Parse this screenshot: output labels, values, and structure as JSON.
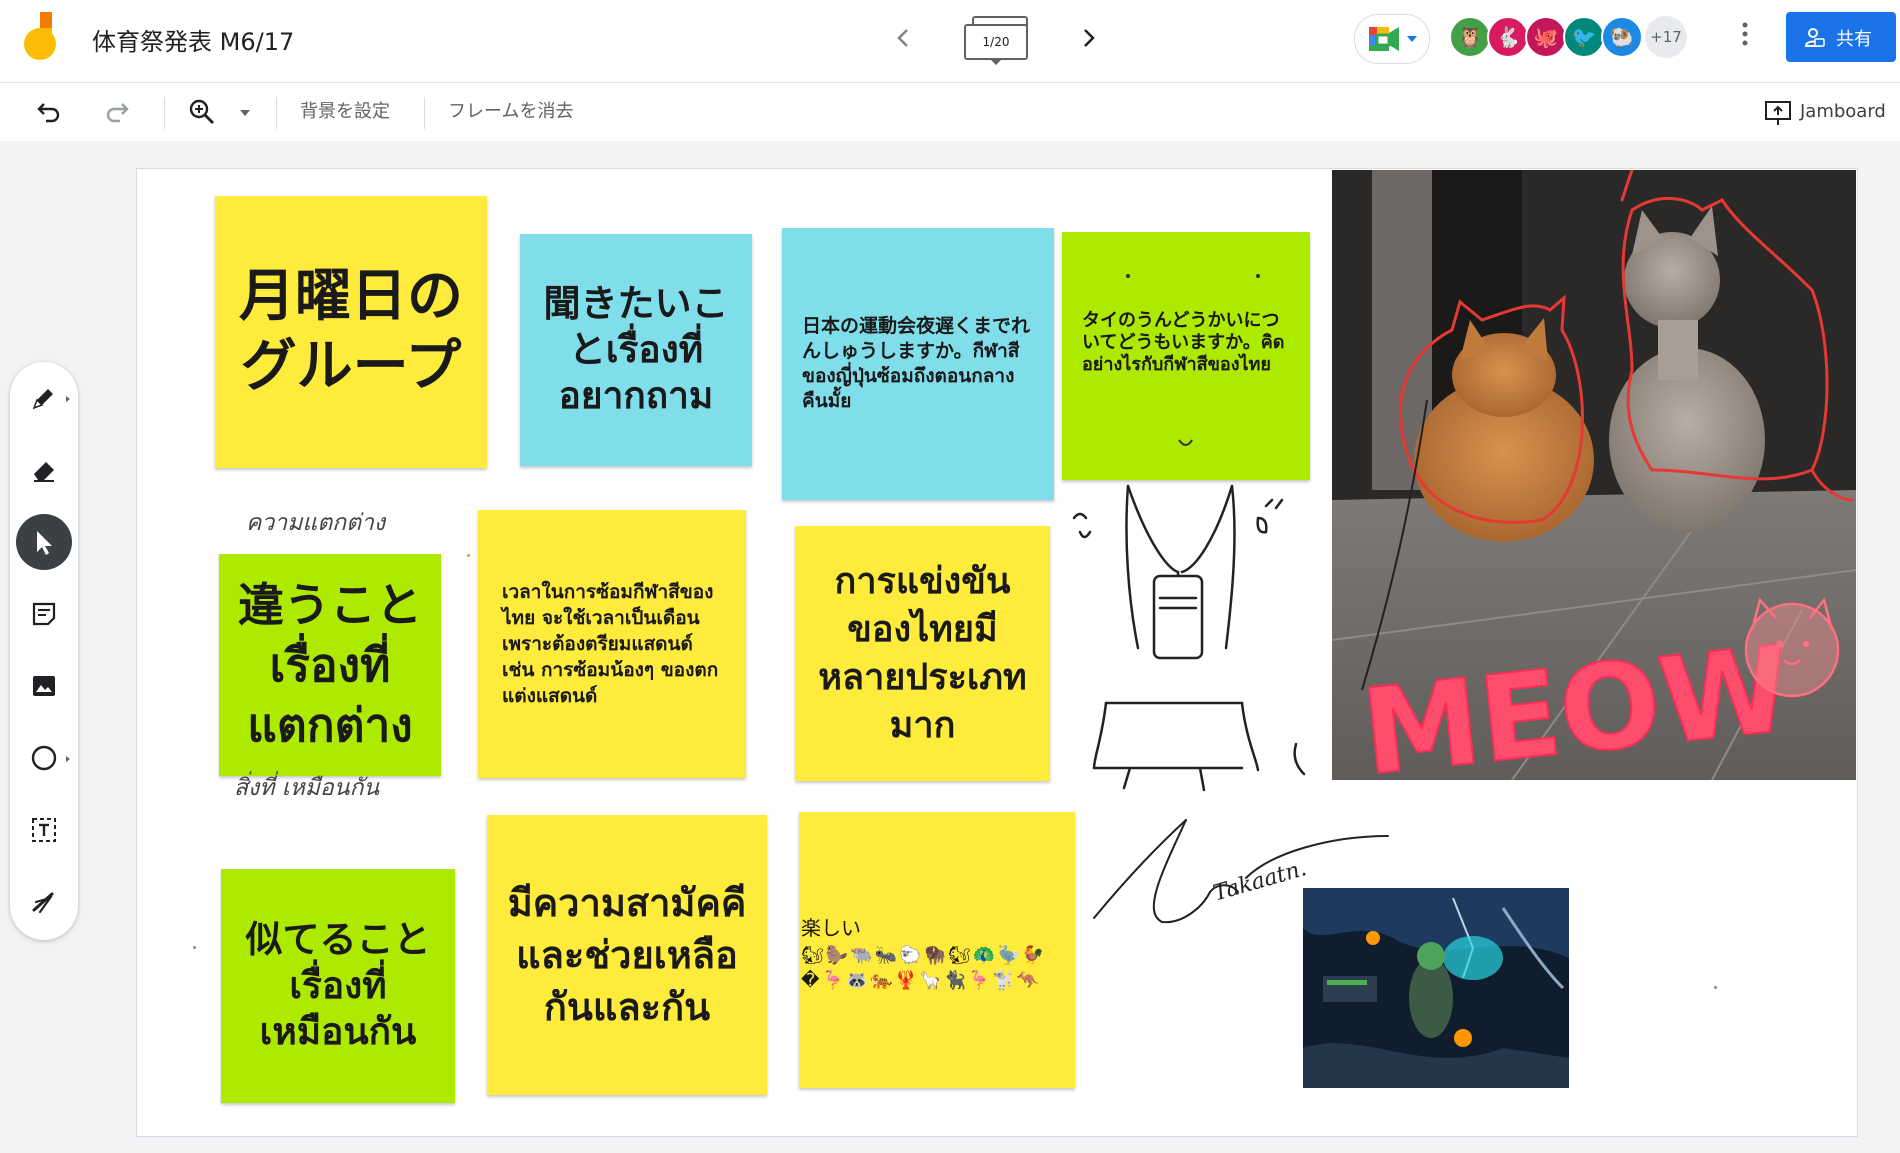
{
  "app": {
    "doc_title": "体育祭発表 M6/17",
    "frame_counter": "1/20",
    "share_label": "共有",
    "more_participants": "+17"
  },
  "toolbar": {
    "set_background": "背景を設定",
    "clear_frame": "フレームを消去",
    "jamboard": "Jamboard"
  },
  "colors": {
    "yellow_note": "#ffeb3b",
    "blue_note": "#80deea",
    "green_note": "#aeea00",
    "share_blue": "#1a73e8"
  },
  "avatars": [
    {
      "icon": "owl-icon",
      "color": "#43a047"
    },
    {
      "icon": "rabbit-icon",
      "color": "#d81b60"
    },
    {
      "icon": "octopus-icon",
      "color": "#c2185b"
    },
    {
      "icon": "bird-icon",
      "color": "#00897b"
    },
    {
      "icon": "ram-icon",
      "color": "#1e88e5"
    }
  ],
  "notes": {
    "monday_group": "月曜日のグループ",
    "want_to_ask": "聞きたいことเรื่องที่อยากถาม",
    "japan_sports_day": "日本の運動会夜遅くまでれんしゅうしますか。กีฬาสีของญี่ปุ่นซ้อมถึงตอนกลางคืนมั้ย",
    "thailand_sports_day": "タイのうんどうかいについてどうもいますか。คิดอย่างไรกับกีฬาสีของไทย",
    "different_things": "違うことเรื่องที่แตกต่าง",
    "practice_time": "เวลาในการซ้อมกีฬาสีของไทย จะใช้เวลาเป็นเดือน เพราะต้องตรียมแสดนด์ เช่น การซ้อมน้องๆ ของตกแต่งแสดนด์",
    "many_competitions": "การแข่งขันของไทยมีหลายประเภทมาก",
    "similar_things": "似てることเรื่องที่เหมือนกัน",
    "unity": "มีความสามัคคี และช่วยเหลือกันและกัน",
    "fun": "楽しい",
    "fun_emoji_row1": "🐿🦫🐃🐜🐑🦬🐿🦚🦤🐓",
    "fun_emoji_row2": "�🦩🦝🐅🦞🦙🐈‍⬛🦩🐩🦘"
  },
  "handwriting": {
    "differences": "ความแตกต่าง",
    "same_things": "สิ่งที่ เหมือนกัน",
    "meow": "MEOW",
    "signature": "Takaatn."
  }
}
